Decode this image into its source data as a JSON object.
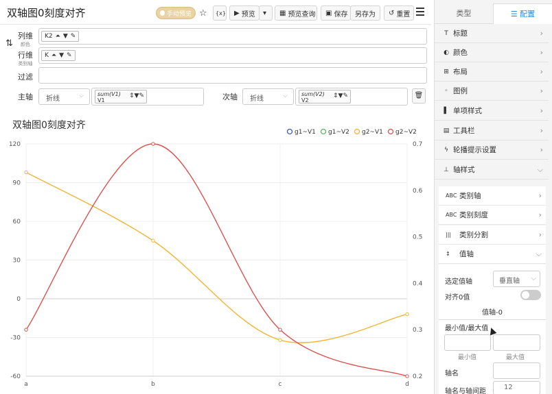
{
  "app": {
    "title": "双轴图0刻度对齐"
  },
  "toolbar": {
    "manual_preview": "手动预览",
    "variable": "{x}",
    "preview": "预览",
    "preview_query": "预览查询",
    "save": "保存",
    "save_as": "另存为",
    "reset": "重置"
  },
  "rows": {
    "column": {
      "label": "列维",
      "sub": "颜色",
      "pill": "K2"
    },
    "row": {
      "label": "行维",
      "sub": "类别轴",
      "pill": "K"
    },
    "filter": {
      "label": "过滤"
    },
    "primary": {
      "label": "主轴",
      "chart_type": "折线",
      "agg": "sum(V1)",
      "field": "V1"
    },
    "secondary": {
      "label": "次轴",
      "chart_type": "折线",
      "agg": "sum(V2)",
      "field": "V2"
    }
  },
  "chart": {
    "title": "双轴图0刻度对齐"
  },
  "chart_data": {
    "type": "line",
    "title": "双轴图0刻度对齐",
    "categories": [
      "a",
      "b",
      "c",
      "d"
    ],
    "ylim": [
      -60,
      120
    ],
    "y2lim": [
      0.2,
      0.7
    ],
    "y_ticks": [
      "120",
      "90",
      "60",
      "30",
      "0",
      "-30",
      "-60"
    ],
    "y2_ticks": [
      "0.7",
      "0.6",
      "0.5",
      "0.4",
      "0.3",
      "0.2"
    ],
    "legend_position": "top-right",
    "grid": true,
    "series": [
      {
        "name": "g1~V1",
        "color": "#3a5ea8",
        "axis": "left",
        "values": []
      },
      {
        "name": "g1~V2",
        "color": "#5bb65b",
        "axis": "right",
        "values": []
      },
      {
        "name": "g2~V1",
        "color": "#f0b631",
        "axis": "left",
        "values": [
          98,
          45,
          -32,
          -12
        ]
      },
      {
        "name": "g2~V2",
        "color": "#d9534f",
        "axis": "right",
        "values": [
          0.3,
          0.7,
          0.3,
          0.2
        ]
      }
    ]
  },
  "panel": {
    "tabs": [
      "类型",
      "配置"
    ],
    "sections": [
      "标题",
      "颜色",
      "布局",
      "图例",
      "单项样式",
      "工具栏",
      "轮播提示设置",
      "轴样式"
    ],
    "subsections": [
      "类别轴",
      "类别刻度",
      "类别分割",
      "值轴"
    ],
    "selected_axis_label": "选定值轴",
    "selected_axis_value": "垂直轴",
    "align_zero": "对齐0值",
    "axis_heading": "值轴-0",
    "minmax_label": "最小值/最大值",
    "min_label": "最小值",
    "max_label": "最大值",
    "axis_name": "轴名",
    "axis_gap": "轴名与轴间距",
    "axis_gap_value": "12"
  }
}
